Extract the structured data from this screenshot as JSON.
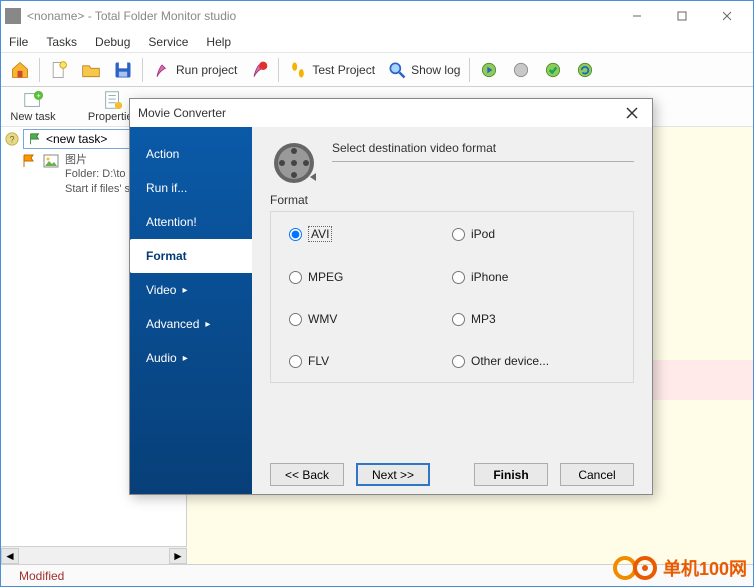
{
  "window": {
    "title": "<noname> - Total Folder Monitor studio",
    "menus": [
      "File",
      "Tasks",
      "Debug",
      "Service",
      "Help"
    ],
    "toolbar": {
      "run_project": "Run project",
      "test_project": "Test Project",
      "show_log": "Show log"
    },
    "subtoolbar": {
      "new_task": "New task",
      "properties": "Properties"
    },
    "left": {
      "task_tab": "<new task>",
      "node_title": "图片",
      "node_line1": "Folder: D:\\to",
      "node_line2": "Start if files' s"
    },
    "status": "Modified"
  },
  "dialog": {
    "title": "Movie Converter",
    "sidebar": {
      "action": "Action",
      "runif": "Run if...",
      "attention": "Attention!",
      "format": "Format",
      "video": "Video",
      "advanced": "Advanced",
      "audio": "Audio"
    },
    "heading": "Select destination video format",
    "group_label": "Format",
    "options": {
      "avi": "AVI",
      "ipod": "iPod",
      "mpeg": "MPEG",
      "iphone": "iPhone",
      "wmv": "WMV",
      "mp3": "MP3",
      "flv": "FLV",
      "other": "Other device..."
    },
    "buttons": {
      "back": "<< Back",
      "next": "Next >>",
      "finish": "Finish",
      "cancel": "Cancel"
    }
  },
  "watermark": "单机100网"
}
